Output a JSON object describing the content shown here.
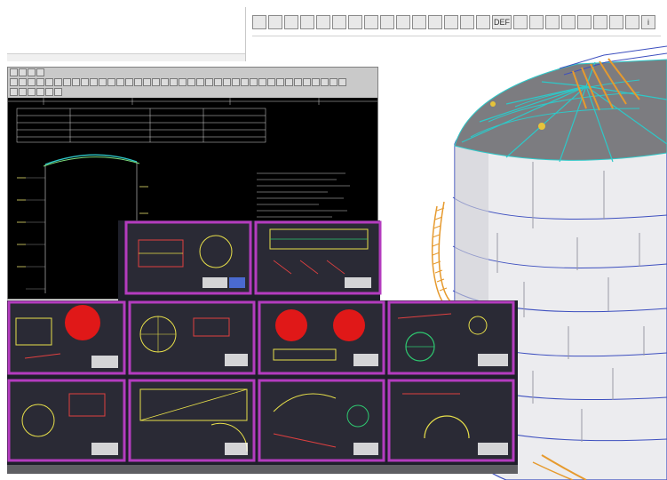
{
  "toolbar": {
    "buttons": [
      {
        "name": "print-icon"
      },
      {
        "name": "layers-icon"
      },
      {
        "name": "layers-alt-icon"
      },
      {
        "name": "grid-icon"
      },
      {
        "name": "zoom-icon"
      },
      {
        "name": "zoom-window-icon"
      },
      {
        "name": "zoom-extents-icon"
      },
      {
        "name": "axis-xy-icon"
      },
      {
        "name": "axis-xz-icon"
      },
      {
        "name": "axis-yz-icon"
      },
      {
        "name": "axis-iso1-icon"
      },
      {
        "name": "axis-iso2-icon"
      },
      {
        "name": "axis-iso3-icon"
      },
      {
        "name": "axis-iso4-icon"
      },
      {
        "name": "rotate-icon"
      },
      {
        "name": "def-icon",
        "label": "DEF"
      },
      {
        "name": "sun-icon"
      },
      {
        "name": "brush-icon"
      },
      {
        "name": "pencil-icon"
      },
      {
        "name": "copy-icon"
      },
      {
        "name": "panel-left-icon"
      },
      {
        "name": "panel-right-icon"
      },
      {
        "name": "monitor-icon"
      },
      {
        "name": "save-icon"
      },
      {
        "name": "info-icon",
        "label": "i"
      }
    ]
  },
  "colors": {
    "sheet_border": "#b43cbf",
    "sheet_bg": "#2a2a35",
    "cad_bg": "#000000",
    "tank_shell": "#e9e9ec",
    "tank_roof": "#7c7c80",
    "stair": "#e69a2e",
    "rafter": "#2ec8c8"
  }
}
